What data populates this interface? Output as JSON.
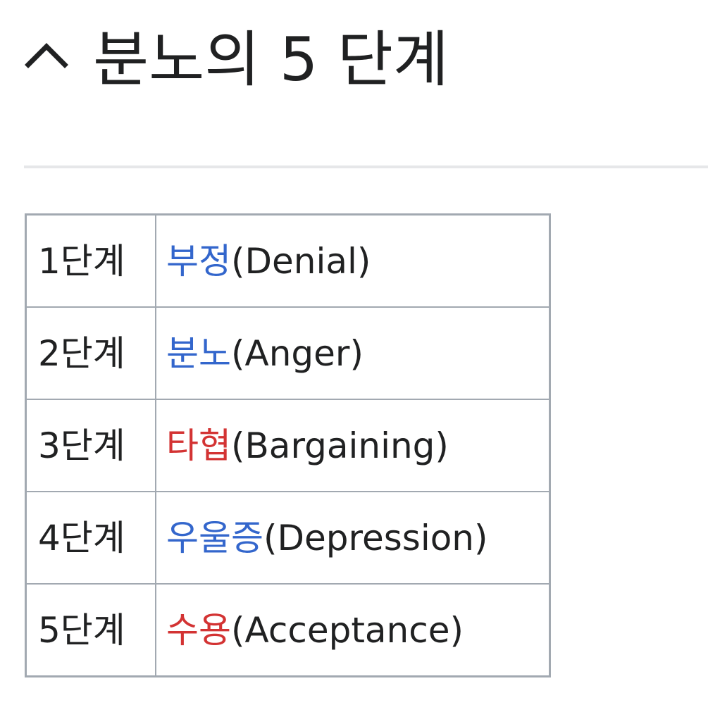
{
  "section": {
    "toggle_icon": "chevron-up-icon",
    "title": "분노의 5 단계"
  },
  "colors": {
    "link_blue": "#3366cc",
    "link_red": "#d33333",
    "text": "#202122",
    "border": "#a2a9b1",
    "divider": "#e6e7e9"
  },
  "stages": [
    {
      "step": "1단계",
      "korean": "부정",
      "english": "(Denial)",
      "link_color": "#3366cc"
    },
    {
      "step": "2단계",
      "korean": "분노",
      "english": "(Anger)",
      "link_color": "#3366cc"
    },
    {
      "step": "3단계",
      "korean": "타협",
      "english": "(Bargaining)",
      "link_color": "#d33333"
    },
    {
      "step": "4단계",
      "korean": "우울증",
      "english": "(Depression)",
      "link_color": "#3366cc"
    },
    {
      "step": "5단계",
      "korean": "수용",
      "english": "(Acceptance)",
      "link_color": "#d33333"
    }
  ]
}
